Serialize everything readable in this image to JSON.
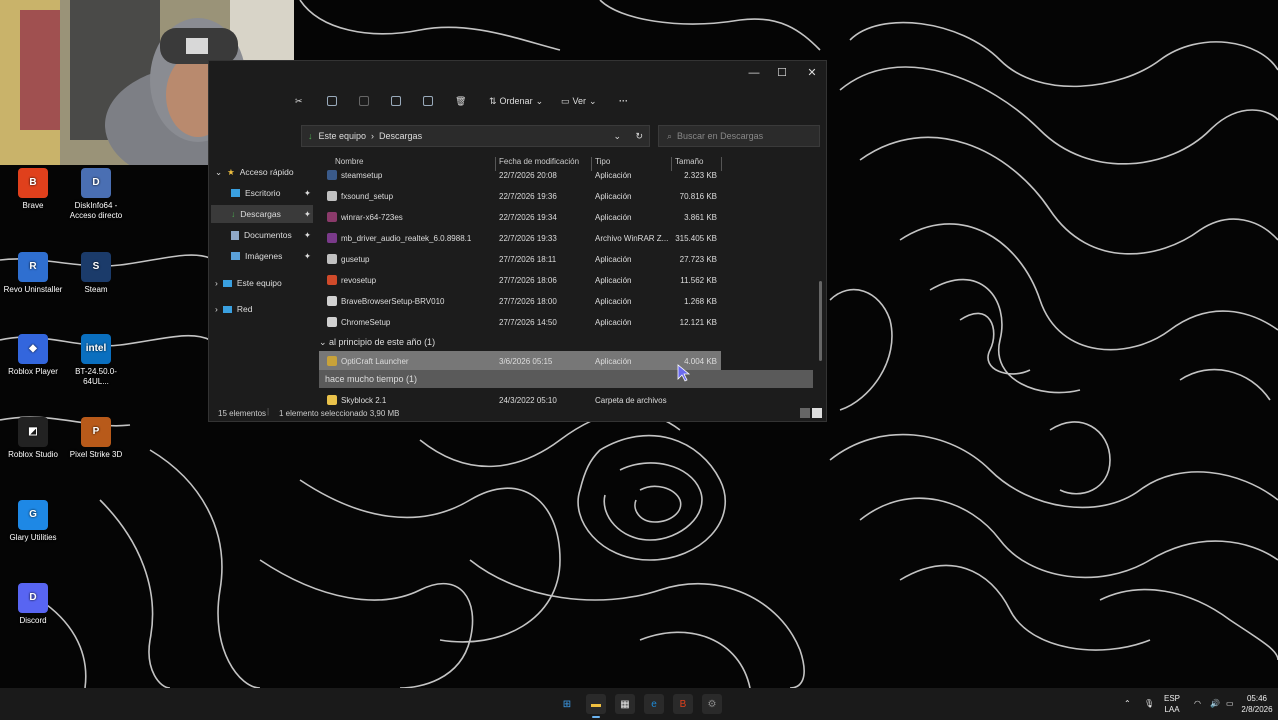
{
  "desktop": {
    "icons": [
      {
        "label": "Brave",
        "color": "#e0401c",
        "glyph": "B"
      },
      {
        "label": "DiskInfo64 -\nAcceso directo",
        "color": "#4a6fb3",
        "glyph": "D"
      },
      {
        "label": "Revo Uninstaller",
        "color": "#2f6fd0",
        "glyph": "R"
      },
      {
        "label": "Steam",
        "color": "#1b3b6a",
        "glyph": "S"
      },
      {
        "label": "Roblox Player",
        "color": "#3366dd",
        "glyph": "◆"
      },
      {
        "label": "BT-24.50.0-64UL...",
        "color": "#0a6fbf",
        "glyph": "intel"
      },
      {
        "label": "Roblox Studio",
        "color": "#222222",
        "glyph": "◩"
      },
      {
        "label": "Pixel Strike 3D",
        "color": "#b85a1a",
        "glyph": "P"
      },
      {
        "label": "Glary Utilities",
        "color": "#1e88e5",
        "glyph": "G"
      },
      {
        "label": "Discord",
        "color": "#5865f2",
        "glyph": "D"
      }
    ]
  },
  "explorer": {
    "toolbar": {
      "sort_label": "Ordenar",
      "view_label": "Ver",
      "more_label": "···"
    },
    "address": {
      "segments": [
        "Este equipo",
        "Descargas"
      ]
    },
    "search": {
      "placeholder": "Buscar en Descargas"
    },
    "nav": {
      "quick_access": "Acceso rápido",
      "items": [
        "Escritorio",
        "Descargas",
        "Documentos",
        "Imágenes"
      ],
      "this_pc": "Este equipo",
      "network": "Red"
    },
    "columns": {
      "name": "Nombre",
      "date": "Fecha de modificación",
      "type": "Tipo",
      "size": "Tamaño"
    },
    "rows": [
      {
        "name": "steamsetup",
        "date": "22/7/2026 20:08",
        "type": "Aplicación",
        "size": "2.323 KB",
        "color": "#3a5a8a"
      },
      {
        "name": "fxsound_setup",
        "date": "22/7/2026 19:36",
        "type": "Aplicación",
        "size": "70.816 KB",
        "color": "#c0c0c0"
      },
      {
        "name": "winrar-x64-723es",
        "date": "22/7/2026 19:34",
        "type": "Aplicación",
        "size": "3.861 KB",
        "color": "#8a3a6a"
      },
      {
        "name": "mb_driver_audio_realtek_6.0.8988.1",
        "date": "22/7/2026 19:33",
        "type": "Archivo WinRAR Z...",
        "size": "315.405 KB",
        "color": "#7a3a8a"
      },
      {
        "name": "gusetup",
        "date": "27/7/2026 18:11",
        "type": "Aplicación",
        "size": "27.723 KB",
        "color": "#c0c0c0"
      },
      {
        "name": "revosetup",
        "date": "27/7/2026 18:06",
        "type": "Aplicación",
        "size": "11.562 KB",
        "color": "#d04a2a"
      },
      {
        "name": "BraveBrowserSetup-BRV010",
        "date": "27/7/2026 18:00",
        "type": "Aplicación",
        "size": "1.268 KB",
        "color": "#d0d0d0"
      },
      {
        "name": "ChromeSetup",
        "date": "27/7/2026 14:50",
        "type": "Aplicación",
        "size": "12.121 KB",
        "color": "#d0d0d0"
      }
    ],
    "group_year": "al principio de este año (1)",
    "selected_row": {
      "name": "OptiCraft Launcher",
      "date": "3/6/2026 05:15",
      "type": "Aplicación",
      "size": "4.004 KB",
      "color": "#c8a23a"
    },
    "group_old": "hace mucho tiempo (1)",
    "last_row": {
      "name": "Skyblock 2.1",
      "date": "24/3/2022 05:10",
      "type": "Carpeta de archivos",
      "size": "",
      "color": "#e8c14a"
    },
    "status": {
      "count": "15 elementos",
      "selection": "1 elemento seleccionado  3,90 MB"
    }
  },
  "taskbar": {
    "apps": [
      {
        "name": "start",
        "color": "#3ea0f0",
        "glyph": "⊞"
      },
      {
        "name": "file-explorer",
        "color": "#f0c040",
        "glyph": "▬"
      },
      {
        "name": "store",
        "color": "#e8e8e8",
        "glyph": "▦"
      },
      {
        "name": "edge",
        "color": "#1e8ad6",
        "glyph": "e"
      },
      {
        "name": "brave",
        "color": "#e0401c",
        "glyph": "B"
      },
      {
        "name": "settings",
        "color": "#888888",
        "glyph": "⚙"
      }
    ],
    "lang": "ESP",
    "lang2": "LAA",
    "time": "05:46",
    "date": "2/8/2026"
  }
}
